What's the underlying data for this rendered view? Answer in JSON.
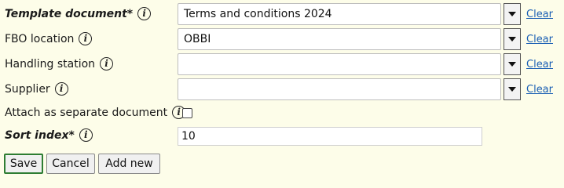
{
  "form": {
    "template_document": {
      "label": "Template document*",
      "value": "Terms and conditions 2024",
      "clear": "Clear"
    },
    "fbo_location": {
      "label": "FBO location",
      "value": "OBBI",
      "clear": "Clear"
    },
    "handling_station": {
      "label": "Handling station",
      "value": "",
      "clear": "Clear"
    },
    "supplier": {
      "label": "Supplier",
      "value": "",
      "clear": "Clear"
    },
    "attach_separate": {
      "label": "Attach as separate document",
      "checked": false
    },
    "sort_index": {
      "label": "Sort index*",
      "value": "10"
    }
  },
  "buttons": {
    "save": "Save",
    "cancel": "Cancel",
    "add_new": "Add new"
  },
  "icons": {
    "info": "info-icon",
    "dropdown": "chevron-down-icon"
  },
  "colors": {
    "background": "#fdfde9",
    "link": "#1a5fb4",
    "save_border": "#2e7d32"
  }
}
